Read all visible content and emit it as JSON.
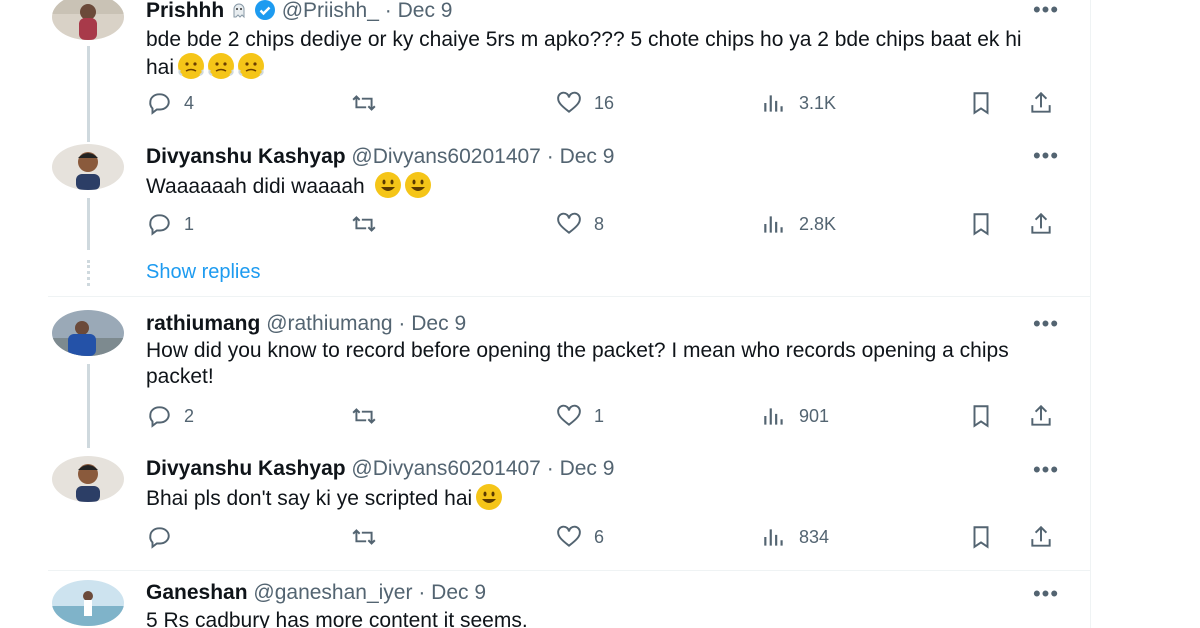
{
  "colors": {
    "accent": "#1d9bf0",
    "text": "#0f1419",
    "muted": "#536471",
    "line": "#cfd9de"
  },
  "tweets": [
    {
      "name": "Prishhh",
      "handle": "@Priishh_",
      "date": "Dec 9",
      "separator": "·",
      "text": "bde bde 2 chips dediye or ky chaiye 5rs m apko??? 5 chote chips ho ya 2 bde chips baat ek hi hai",
      "emojis": [
        "face-with-steam-icon",
        "face-with-steam-icon",
        "face-with-steam-icon"
      ],
      "replies": "4",
      "retweets": "",
      "likes": "16",
      "views": "3.1K"
    },
    {
      "name": "Divyanshu Kashyap",
      "handle": "@Divyans60201407",
      "date": "Dec 9",
      "separator": "·",
      "text": "Waaaaaah didi waaaah",
      "emojis": [
        "grinning-face-icon",
        "grinning-face-icon"
      ],
      "replies": "1",
      "retweets": "",
      "likes": "8",
      "views": "2.8K"
    },
    {
      "name": "rathiumang",
      "handle": "@rathiumang",
      "date": "Dec 9",
      "separator": "·",
      "text": "How did you know to record before opening the packet? I mean who records opening a chips packet!",
      "replies": "2",
      "retweets": "",
      "likes": "1",
      "views": "901"
    },
    {
      "name": "Divyanshu Kashyap",
      "handle": "@Divyans60201407",
      "date": "Dec 9",
      "separator": "·",
      "text": "Bhai pls don't say ki ye scripted hai",
      "emojis": [
        "grinning-face-icon"
      ],
      "replies": "",
      "retweets": "",
      "likes": "6",
      "views": "834"
    },
    {
      "name": "Ganeshan",
      "handle": "@ganeshan_iyer",
      "date": "Dec 9",
      "separator": "·",
      "text": "5 Rs cadbury has more content it seems."
    }
  ],
  "show_replies": "Show replies",
  "more_label": "•••"
}
